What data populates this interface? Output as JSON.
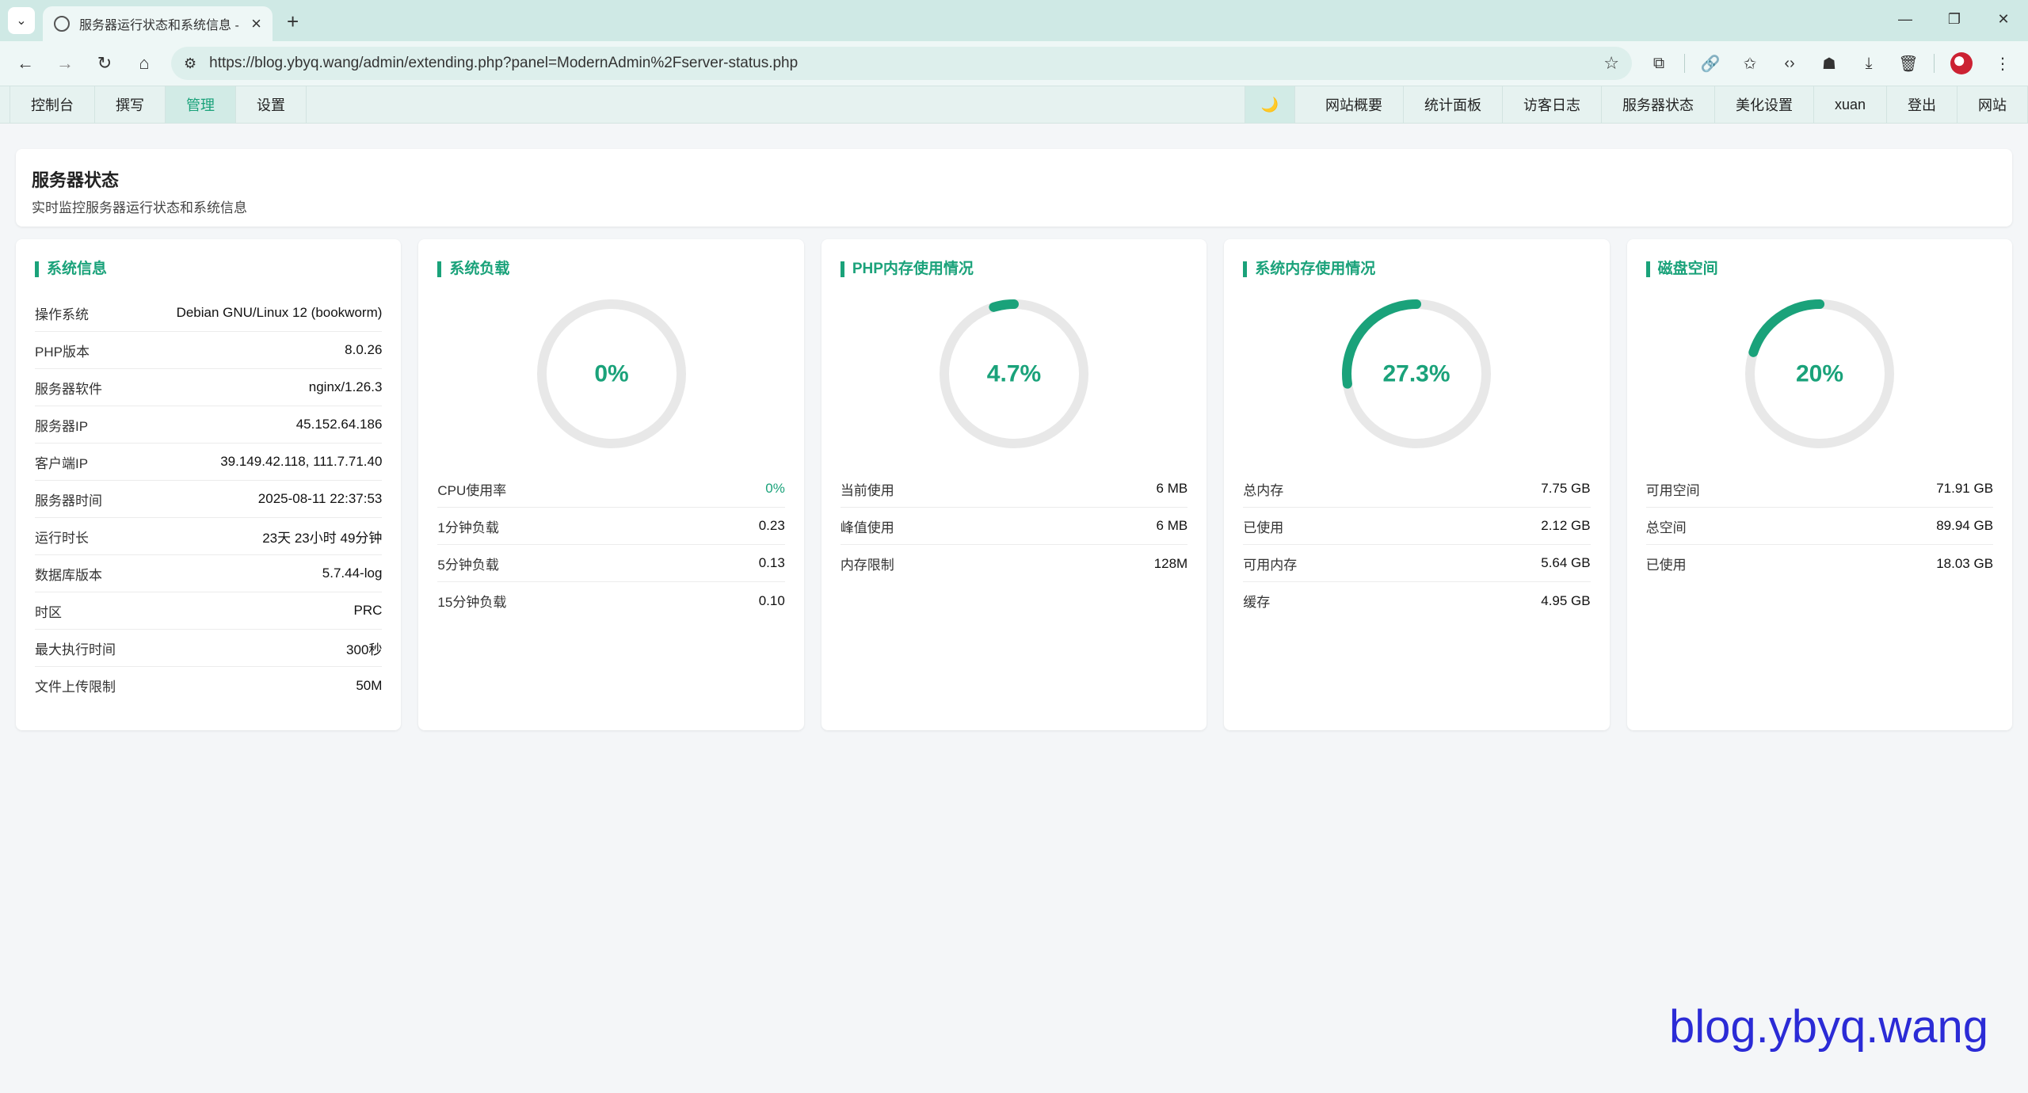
{
  "browser": {
    "tab_title": "服务器运行状态和系统信息 - X",
    "url": "https://blog.ybyq.wang/admin/extending.php?panel=ModernAdmin%2Fserver-status.php"
  },
  "adminnav": {
    "left": [
      "控制台",
      "撰写",
      "管理",
      "设置"
    ],
    "active": "管理",
    "theme_icon": "🌙",
    "right": [
      "网站概要",
      "统计面板",
      "访客日志",
      "服务器状态",
      "美化设置",
      "xuan",
      "登出",
      "网站"
    ]
  },
  "page": {
    "title": "服务器状态",
    "subtitle": "实时监控服务器运行状态和系统信息"
  },
  "system_info": {
    "title": "系统信息",
    "rows": [
      {
        "label": "操作系统",
        "value": "Debian GNU/Linux 12 (bookworm)"
      },
      {
        "label": "PHP版本",
        "value": "8.0.26"
      },
      {
        "label": "服务器软件",
        "value": "nginx/1.26.3"
      },
      {
        "label": "服务器IP",
        "value": "45.152.64.186"
      },
      {
        "label": "客户端IP",
        "value": "39.149.42.118, 111.7.71.40"
      },
      {
        "label": "服务器时间",
        "value": "2025-08-11 22:37:53"
      },
      {
        "label": "运行时长",
        "value": "23天 23小时 49分钟"
      },
      {
        "label": "数据库版本",
        "value": "5.7.44-log"
      },
      {
        "label": "时区",
        "value": "PRC"
      },
      {
        "label": "最大执行时间",
        "value": "300秒"
      },
      {
        "label": "文件上传限制",
        "value": "50M"
      }
    ]
  },
  "system_load": {
    "title": "系统负载",
    "gauge_label": "0%",
    "gauge_fraction": 0,
    "rows": [
      {
        "label": "CPU使用率",
        "value": "0%"
      },
      {
        "label": "1分钟负载",
        "value": "0.23"
      },
      {
        "label": "5分钟负载",
        "value": "0.13"
      },
      {
        "label": "15分钟负载",
        "value": "0.10"
      }
    ]
  },
  "php_memory": {
    "title": "PHP内存使用情况",
    "gauge_label": "4.7%",
    "gauge_fraction": 0.047,
    "rows": [
      {
        "label": "当前使用",
        "value": "6 MB"
      },
      {
        "label": "峰值使用",
        "value": "6 MB"
      },
      {
        "label": "内存限制",
        "value": "128M"
      }
    ]
  },
  "sys_memory": {
    "title": "系统内存使用情况",
    "gauge_label": "27.3%",
    "gauge_fraction": 0.273,
    "rows": [
      {
        "label": "总内存",
        "value": "7.75 GB"
      },
      {
        "label": "已使用",
        "value": "2.12 GB"
      },
      {
        "label": "可用内存",
        "value": "5.64 GB"
      },
      {
        "label": "缓存",
        "value": "4.95 GB"
      }
    ]
  },
  "disk": {
    "title": "磁盘空间",
    "gauge_label": "20%",
    "gauge_fraction": 0.2,
    "rows": [
      {
        "label": "可用空间",
        "value": "71.91 GB"
      },
      {
        "label": "总空间",
        "value": "89.94 GB"
      },
      {
        "label": "已使用",
        "value": "18.03 GB"
      }
    ]
  },
  "colors": {
    "accent": "#1aa27a",
    "track": "#e8e8e8"
  },
  "watermark": "blog.ybyq.wang"
}
